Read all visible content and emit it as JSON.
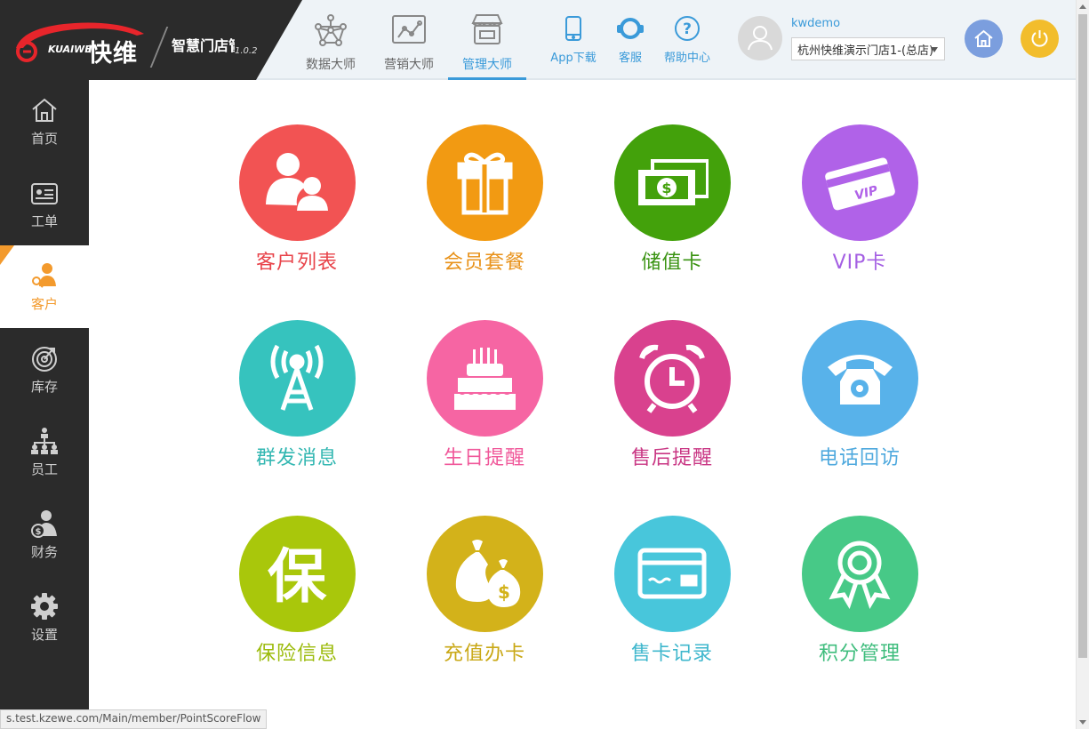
{
  "header": {
    "brand_en": "KUAIWEI",
    "brand_cn": "快维",
    "product_name": "智慧门店管理系统",
    "version": "1.0.2",
    "tabs": [
      {
        "label": "数据大师",
        "icon": "network-icon",
        "active": false
      },
      {
        "label": "营销大师",
        "icon": "trend-chart-icon",
        "active": false
      },
      {
        "label": "管理大师",
        "icon": "store-icon",
        "active": true
      }
    ],
    "tools": [
      {
        "label": "App下载",
        "icon": "mobile-phone-icon"
      },
      {
        "label": "客服",
        "icon": "headset-icon"
      },
      {
        "label": "帮助中心",
        "icon": "help-icon"
      }
    ],
    "username": "kwdemo",
    "store_selected": "杭州快维演示门店1-(总店)",
    "home_button_color": "#7b9ede",
    "power_button_color": "#f2bd2c"
  },
  "sidebar": {
    "items": [
      {
        "label": "首页",
        "icon": "home-icon",
        "active": false
      },
      {
        "label": "工单",
        "icon": "work-order-icon",
        "active": false
      },
      {
        "label": "客户",
        "icon": "customer-icon",
        "active": true
      },
      {
        "label": "库存",
        "icon": "inventory-icon",
        "active": false
      },
      {
        "label": "员工",
        "icon": "org-chart-icon",
        "active": false
      },
      {
        "label": "财务",
        "icon": "finance-icon",
        "active": false
      },
      {
        "label": "设置",
        "icon": "gear-icon",
        "active": false
      }
    ]
  },
  "tiles": [
    {
      "label": "客户列表",
      "icon": "customers-icon",
      "color": "#f25353"
    },
    {
      "label": "会员套餐",
      "icon": "gift-icon",
      "color": "#f29a12"
    },
    {
      "label": "储值卡",
      "icon": "money-icon",
      "color": "#43a10b"
    },
    {
      "label": "VIP卡",
      "icon": "vip-card-icon",
      "color": "#b062e8",
      "card_text": "VIP"
    },
    {
      "label": "群发消息",
      "icon": "broadcast-tower-icon",
      "color": "#36c3be"
    },
    {
      "label": "生日提醒",
      "icon": "birthday-cake-icon",
      "color": "#f665a3"
    },
    {
      "label": "售后提醒",
      "icon": "alarm-clock-icon",
      "color": "#d9418e"
    },
    {
      "label": "电话回访",
      "icon": "telephone-icon",
      "color": "#58b2ea"
    },
    {
      "label": "保险信息",
      "icon": "insurance-icon",
      "color": "#a9c70b",
      "glyph": "保"
    },
    {
      "label": "充值办卡",
      "icon": "money-bag-icon",
      "color": "#d3b21a"
    },
    {
      "label": "售卡记录",
      "icon": "card-record-icon",
      "color": "#48c6db"
    },
    {
      "label": "积分管理",
      "icon": "award-ribbon-icon",
      "color": "#47c987"
    }
  ],
  "status_url": "s.test.kzewe.com/Main/member/PointScoreFlow"
}
